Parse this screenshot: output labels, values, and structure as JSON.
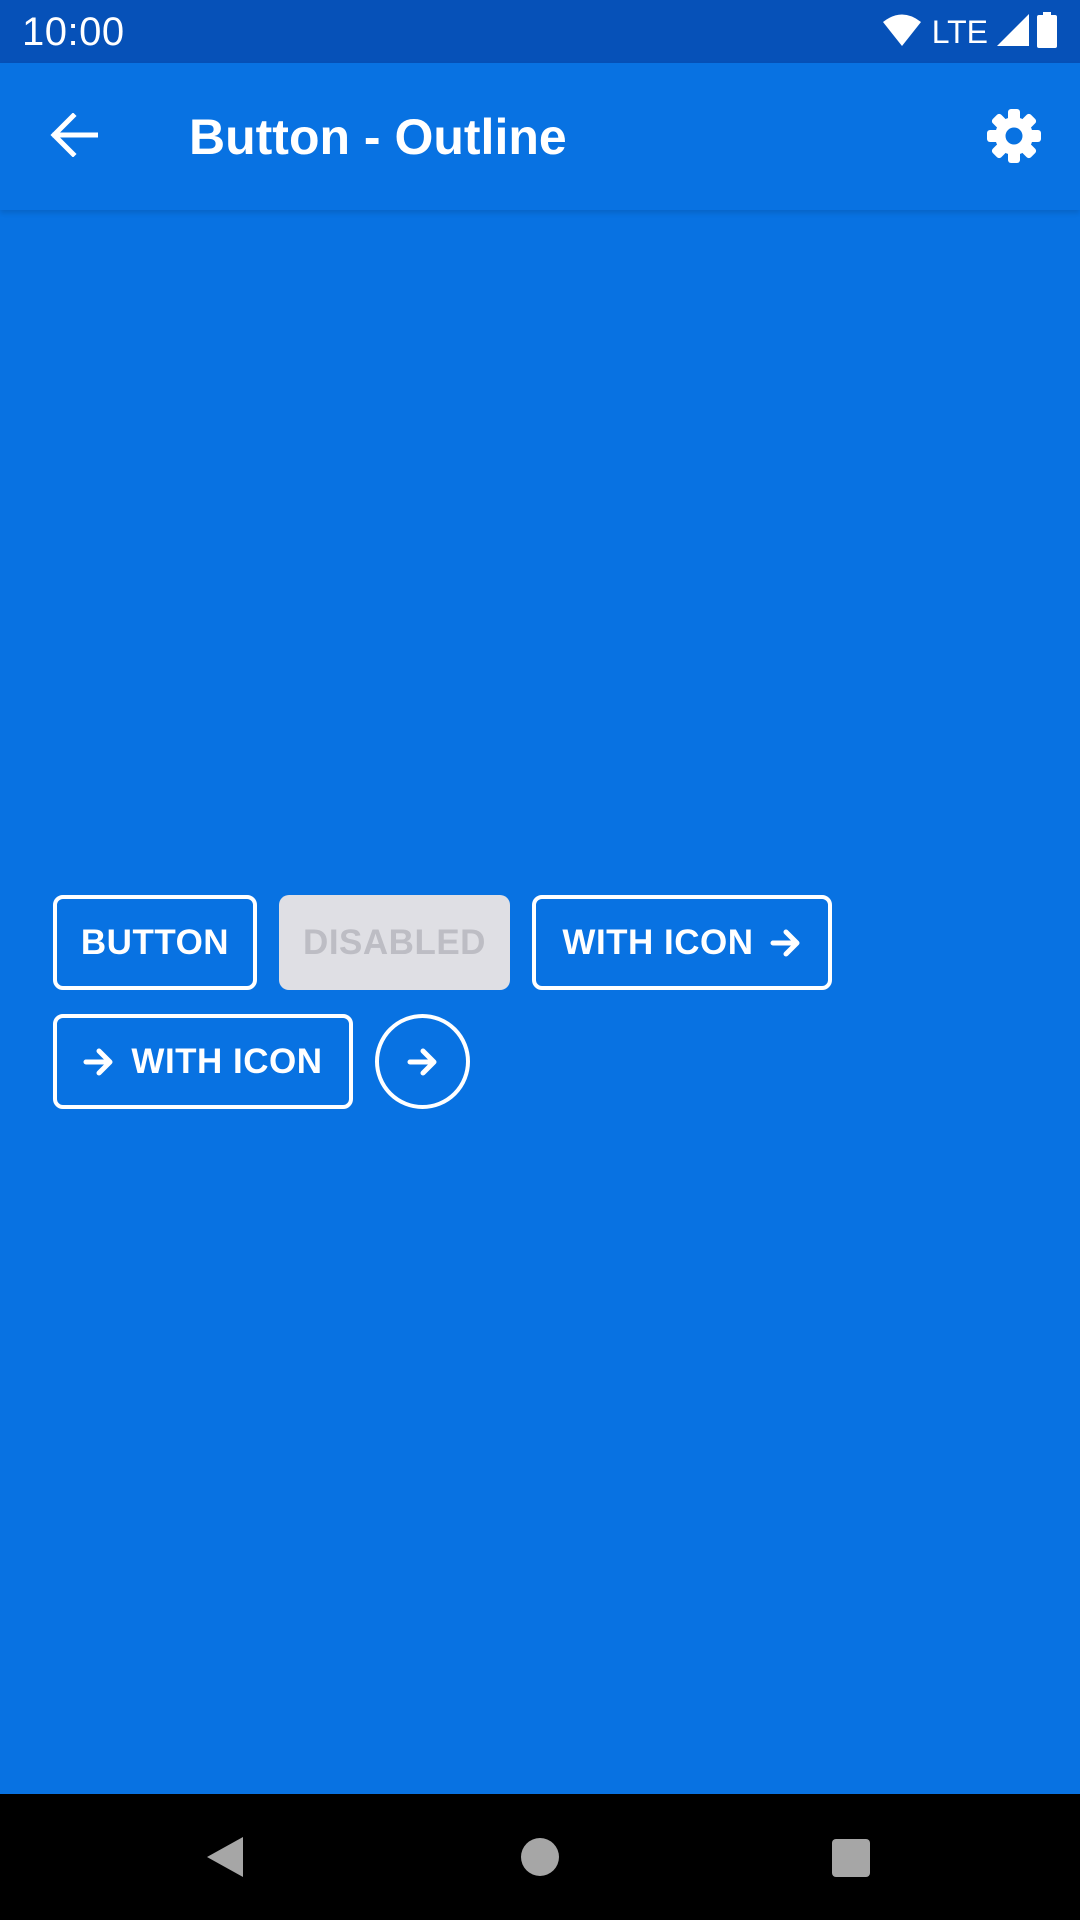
{
  "status_bar": {
    "time": "10:00",
    "network": "LTE",
    "icons": [
      "wifi-icon",
      "signal-icon",
      "battery-icon"
    ]
  },
  "app_bar": {
    "title": "Button - Outline",
    "back_icon": "arrow-back-icon",
    "settings_icon": "gear-icon"
  },
  "buttons": {
    "button_label": "BUTTON",
    "disabled_label": "DISABLED",
    "with_icon_right_label": "WITH ICON",
    "with_icon_left_label": "WITH ICON",
    "icon_name": "arrow-right-icon"
  },
  "colors": {
    "background": "#0872e2",
    "status_bar": "#0651b8",
    "outline": "#ffffff",
    "disabled_bg": "#dfdfe4",
    "disabled_text": "#bdbdc4",
    "nav_bar": "#000000"
  },
  "nav_bar": {
    "icons": [
      "nav-back-icon",
      "nav-home-icon",
      "nav-recents-icon"
    ]
  }
}
